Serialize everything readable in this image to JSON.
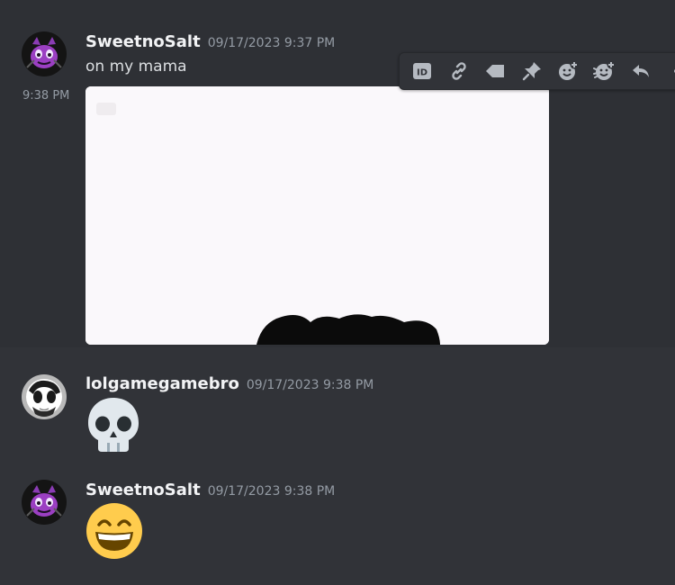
{
  "messages": [
    {
      "username": "SweetnoSalt",
      "timestamp": "09/17/2023 9:37 PM",
      "text": "on my mama",
      "followup_time": "9:38 PM"
    },
    {
      "username": "lolgamegamebro",
      "timestamp": "09/17/2023 9:38 PM",
      "emoji": "skull"
    },
    {
      "username": "SweetnoSalt",
      "timestamp": "09/17/2023 9:38 PM",
      "emoji": "grinning-face-with-smiling-eyes"
    }
  ],
  "toolbar": {
    "buttons": [
      "copy-id-icon",
      "copy-link-icon",
      "mark-unread-icon",
      "pin-icon",
      "add-reaction-icon",
      "super-reaction-icon",
      "reply-icon",
      "more-icon"
    ],
    "id_label": "ID"
  },
  "colors": {
    "background": "#313338",
    "hover_background": "#2e3035",
    "username": "#f2f3f5",
    "timestamp": "#949ba4",
    "text": "#dbdee1",
    "avatar_purple": "#9b3fc2"
  }
}
